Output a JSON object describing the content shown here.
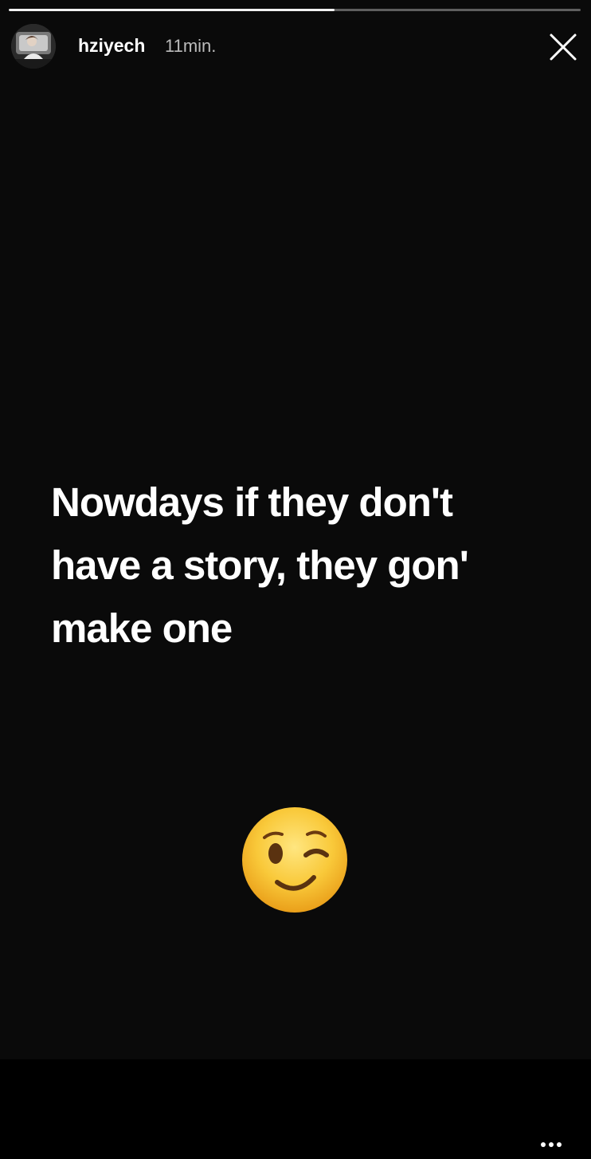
{
  "story": {
    "progress": 0.57,
    "user": {
      "username": "hziyech",
      "time_ago": "11min.",
      "avatar_icon": "profile-photo"
    },
    "close_icon": "close-icon",
    "caption_lines": [
      "Nowdays if they don't",
      "have a story, they gon'",
      "make one"
    ],
    "sticker": "winking-face-emoji",
    "more_icon": "more-options-icon"
  },
  "colors": {
    "background": "#0a0a0a",
    "bottom_bar": "#000000",
    "text": "#ffffff",
    "timestamp": "#b8b8b8",
    "emoji_face": "#f5b82c"
  }
}
